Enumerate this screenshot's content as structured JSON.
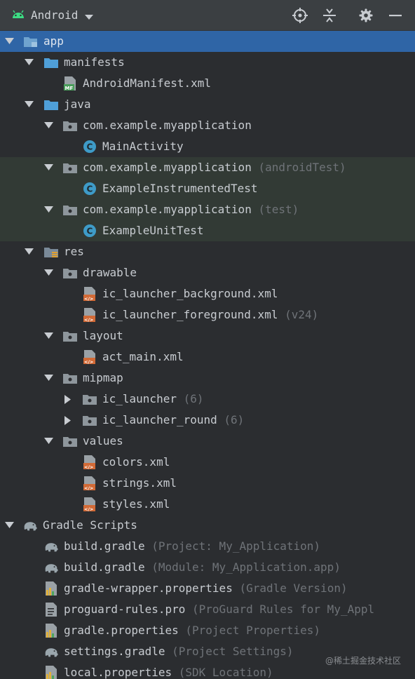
{
  "toolbar": {
    "view_mode": "Android",
    "actions": [
      {
        "name": "locate-icon"
      },
      {
        "name": "collapse-all-icon"
      },
      {
        "name": "gear-icon"
      },
      {
        "name": "minimize-icon"
      }
    ]
  },
  "tree": [
    {
      "depth": 0,
      "arrow": "down",
      "icon": "module-folder",
      "label": "app",
      "hint": "",
      "selected": true
    },
    {
      "depth": 1,
      "arrow": "down",
      "icon": "folder-blue",
      "label": "manifests",
      "hint": ""
    },
    {
      "depth": 2,
      "arrow": "",
      "icon": "manifest-file",
      "label": "AndroidManifest.xml",
      "hint": ""
    },
    {
      "depth": 1,
      "arrow": "down",
      "icon": "folder-blue",
      "label": "java",
      "hint": ""
    },
    {
      "depth": 2,
      "arrow": "down",
      "icon": "package",
      "label": "com.example.myapplication",
      "hint": ""
    },
    {
      "depth": 3,
      "arrow": "",
      "icon": "class",
      "label": "MainActivity",
      "hint": ""
    },
    {
      "depth": 2,
      "arrow": "down",
      "icon": "package",
      "label": "com.example.myapplication",
      "hint": "(androidTest)",
      "tested": true
    },
    {
      "depth": 3,
      "arrow": "",
      "icon": "class",
      "label": "ExampleInstrumentedTest",
      "hint": "",
      "tested": true
    },
    {
      "depth": 2,
      "arrow": "down",
      "icon": "package",
      "label": "com.example.myapplication",
      "hint": "(test)",
      "tested": true
    },
    {
      "depth": 3,
      "arrow": "",
      "icon": "class",
      "label": "ExampleUnitTest",
      "hint": "",
      "tested": true
    },
    {
      "depth": 1,
      "arrow": "down",
      "icon": "res-folder",
      "label": "res",
      "hint": ""
    },
    {
      "depth": 2,
      "arrow": "down",
      "icon": "package",
      "label": "drawable",
      "hint": ""
    },
    {
      "depth": 3,
      "arrow": "",
      "icon": "xml-file",
      "label": "ic_launcher_background.xml",
      "hint": ""
    },
    {
      "depth": 3,
      "arrow": "",
      "icon": "xml-file",
      "label": "ic_launcher_foreground.xml",
      "hint": "(v24)"
    },
    {
      "depth": 2,
      "arrow": "down",
      "icon": "package",
      "label": "layout",
      "hint": ""
    },
    {
      "depth": 3,
      "arrow": "",
      "icon": "xml-file",
      "label": "act_main.xml",
      "hint": ""
    },
    {
      "depth": 2,
      "arrow": "down",
      "icon": "package",
      "label": "mipmap",
      "hint": ""
    },
    {
      "depth": 3,
      "arrow": "right",
      "icon": "package",
      "label": "ic_launcher",
      "hint": "(6)"
    },
    {
      "depth": 3,
      "arrow": "right",
      "icon": "package",
      "label": "ic_launcher_round",
      "hint": "(6)"
    },
    {
      "depth": 2,
      "arrow": "down",
      "icon": "package",
      "label": "values",
      "hint": ""
    },
    {
      "depth": 3,
      "arrow": "",
      "icon": "xml-file",
      "label": "colors.xml",
      "hint": ""
    },
    {
      "depth": 3,
      "arrow": "",
      "icon": "xml-file",
      "label": "strings.xml",
      "hint": ""
    },
    {
      "depth": 3,
      "arrow": "",
      "icon": "xml-file",
      "label": "styles.xml",
      "hint": ""
    },
    {
      "depth": 0,
      "arrow": "down",
      "icon": "gradle-elephant",
      "label": "Gradle Scripts",
      "hint": ""
    },
    {
      "depth": 1,
      "arrow": "",
      "icon": "gradle-elephant",
      "label": "build.gradle",
      "hint": "(Project: My_Application)"
    },
    {
      "depth": 1,
      "arrow": "",
      "icon": "gradle-elephant",
      "label": "build.gradle",
      "hint": "(Module: My_Application.app)"
    },
    {
      "depth": 1,
      "arrow": "",
      "icon": "properties-file",
      "label": "gradle-wrapper.properties",
      "hint": "(Gradle Version)"
    },
    {
      "depth": 1,
      "arrow": "",
      "icon": "text-file",
      "label": "proguard-rules.pro",
      "hint": "(ProGuard Rules for My_Appl"
    },
    {
      "depth": 1,
      "arrow": "",
      "icon": "properties-file",
      "label": "gradle.properties",
      "hint": "(Project Properties)"
    },
    {
      "depth": 1,
      "arrow": "",
      "icon": "gradle-elephant",
      "label": "settings.gradle",
      "hint": "(Project Settings)"
    },
    {
      "depth": 1,
      "arrow": "",
      "icon": "properties-file",
      "label": "local.properties",
      "hint": "(SDK Location)"
    }
  ],
  "watermark": "@稀土掘金技术社区",
  "colors": {
    "background": "#2b2d30",
    "toolbar": "#3b3f42",
    "selection": "#2f65a6",
    "test_scope": "#323a35",
    "hint_text": "#6f7378"
  }
}
